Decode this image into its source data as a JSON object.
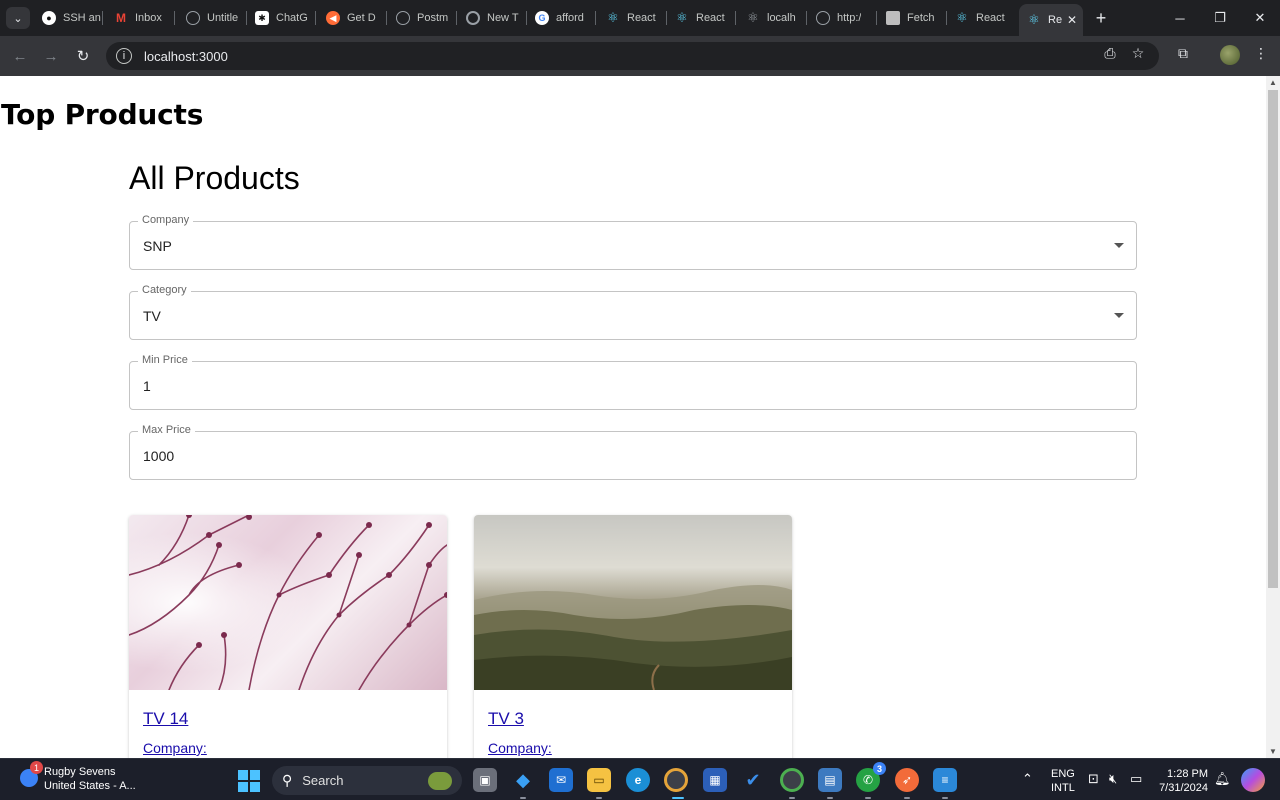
{
  "browser": {
    "tabs": [
      {
        "label": "SSH an",
        "icon": "github-icon",
        "color": "#ffffff"
      },
      {
        "label": "Inbox",
        "icon": "gmail-icon",
        "color": "#ea4335"
      },
      {
        "label": "Untitle",
        "icon": "globe-icon",
        "color": "#9aa0a6"
      },
      {
        "label": "ChatG",
        "icon": "chatgpt-icon",
        "color": "#ffffff"
      },
      {
        "label": "Get D",
        "icon": "postman-icon",
        "color": "#ff6c37"
      },
      {
        "label": "Postm",
        "icon": "globe-icon",
        "color": "#9aa0a6"
      },
      {
        "label": "New T",
        "icon": "chrome-icon",
        "color": "#9aa0a6"
      },
      {
        "label": "afford",
        "icon": "google-icon",
        "color": "#ffffff"
      },
      {
        "label": "React",
        "icon": "react-icon",
        "color": "#61dafb"
      },
      {
        "label": "React",
        "icon": "react-icon",
        "color": "#61dafb"
      },
      {
        "label": "localh",
        "icon": "react-icon",
        "color": "#9aa0a6"
      },
      {
        "label": "http:/",
        "icon": "globe-icon",
        "color": "#9aa0a6"
      },
      {
        "label": "Fetch",
        "icon": "document-icon",
        "color": "#bdbdbd"
      },
      {
        "label": "React",
        "icon": "react-icon",
        "color": "#61dafb"
      }
    ],
    "active_tab": {
      "label": "Re",
      "icon": "react-icon",
      "color": "#61dafb"
    },
    "url": "localhost:3000"
  },
  "page": {
    "heading": "Top Products",
    "section_title": "All Products",
    "filters": [
      {
        "label": "Company",
        "value": "SNP",
        "type": "select"
      },
      {
        "label": "Category",
        "value": "TV",
        "type": "select"
      },
      {
        "label": "Min Price",
        "value": "1",
        "type": "input"
      },
      {
        "label": "Max Price",
        "value": "1000",
        "type": "input"
      }
    ],
    "products": [
      {
        "name": "TV 14",
        "meta_label": "Company:",
        "image": "flower-branches"
      },
      {
        "name": "TV 3",
        "meta_label": "Company:",
        "image": "misty-hills"
      }
    ]
  },
  "taskbar": {
    "weather_title": "Rugby Sevens",
    "weather_subtitle": "United States - A...",
    "weather_badge": "1",
    "search_label": "Search",
    "whatsapp_badge": "3",
    "lang_line1": "ENG",
    "lang_line2": "INTL",
    "time": "1:28 PM",
    "date": "7/31/2024"
  }
}
